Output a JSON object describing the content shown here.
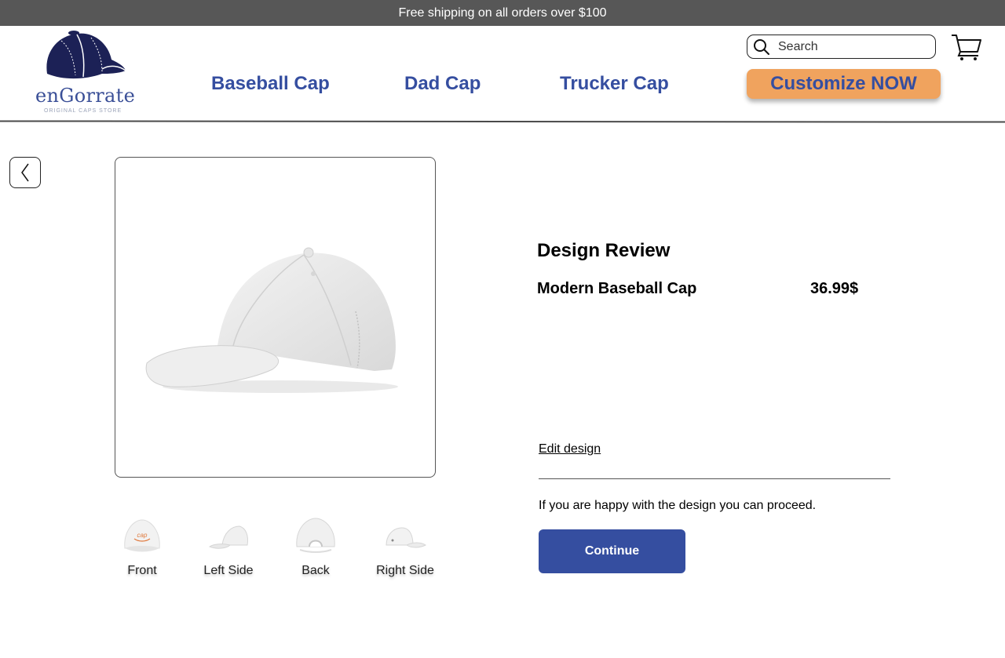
{
  "promo": {
    "text": "Free shipping on all orders over $100"
  },
  "brand": {
    "name": "enGorrate",
    "tagline": "ORIGINAL CAPS STORE",
    "logo_icon": "cap-logo-icon",
    "color": "#3a4f97"
  },
  "nav": {
    "items": [
      {
        "label": "Baseball Cap"
      },
      {
        "label": "Dad Cap"
      },
      {
        "label": "Trucker Cap"
      }
    ],
    "color": "#354ea0"
  },
  "search": {
    "placeholder": "Search",
    "value": "",
    "icon": "search-icon"
  },
  "cart": {
    "icon": "shopping-cart-icon"
  },
  "customize_button": {
    "label": "Customize NOW",
    "bg_color": "#f0a35e"
  },
  "back_button": {
    "icon": "chevron-left-icon"
  },
  "gallery": {
    "main_image": "white-baseball-cap-side-view",
    "thumbnails": [
      {
        "label": "Front"
      },
      {
        "label": "Left Side"
      },
      {
        "label": "Back"
      },
      {
        "label": "Right Side"
      }
    ]
  },
  "review": {
    "title": "Design Review",
    "product_name": "Modern Baseball Cap",
    "price": "36.99$",
    "edit_link": "Edit design",
    "proceed_text": "If you are happy with the design you can proceed.",
    "continue_label": "Continue",
    "continue_color": "#354ea0"
  }
}
